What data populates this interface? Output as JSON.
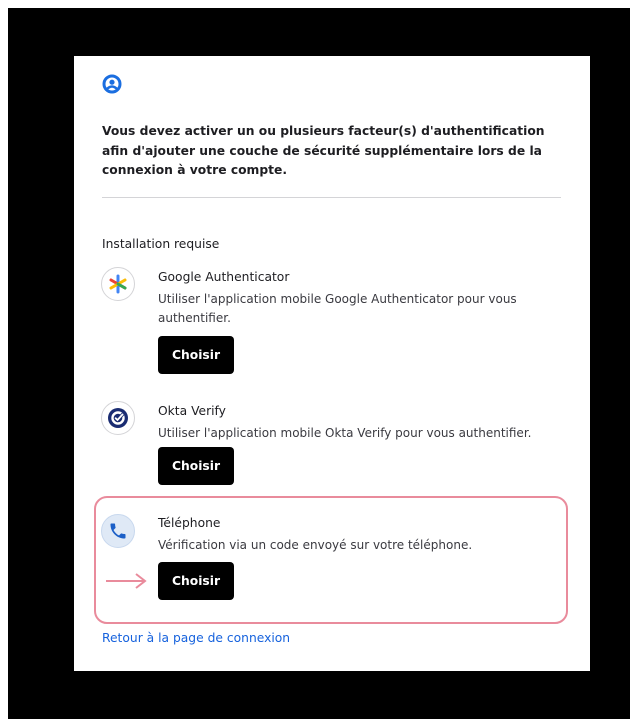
{
  "intro_text": "Vous devez activer un ou plusieurs facteur(s) d'authentification afin d'ajouter une couche de sécurité supplémentaire lors de la connexion à votre compte.",
  "section_title": "Installation requise",
  "authenticators": [
    {
      "name": "Google Authenticator",
      "description": "Utiliser l'application mobile Google Authenticator pour vous authentifier.",
      "button_label": "Choisir",
      "icon": "google-authenticator-icon"
    },
    {
      "name": "Okta Verify",
      "description": "Utiliser l'application mobile Okta Verify pour vous authentifier.",
      "button_label": "Choisir",
      "icon": "okta-verify-icon"
    },
    {
      "name": "Téléphone",
      "description": "Vérification via un code envoyé sur votre téléphone.",
      "button_label": "Choisir",
      "icon": "phone-icon"
    }
  ],
  "back_link": "Retour à la page de connexion",
  "colors": {
    "accent": "#1662dd",
    "button": "#000000",
    "highlight": "#e98b9c",
    "user_icon": "#1b6ee0"
  }
}
